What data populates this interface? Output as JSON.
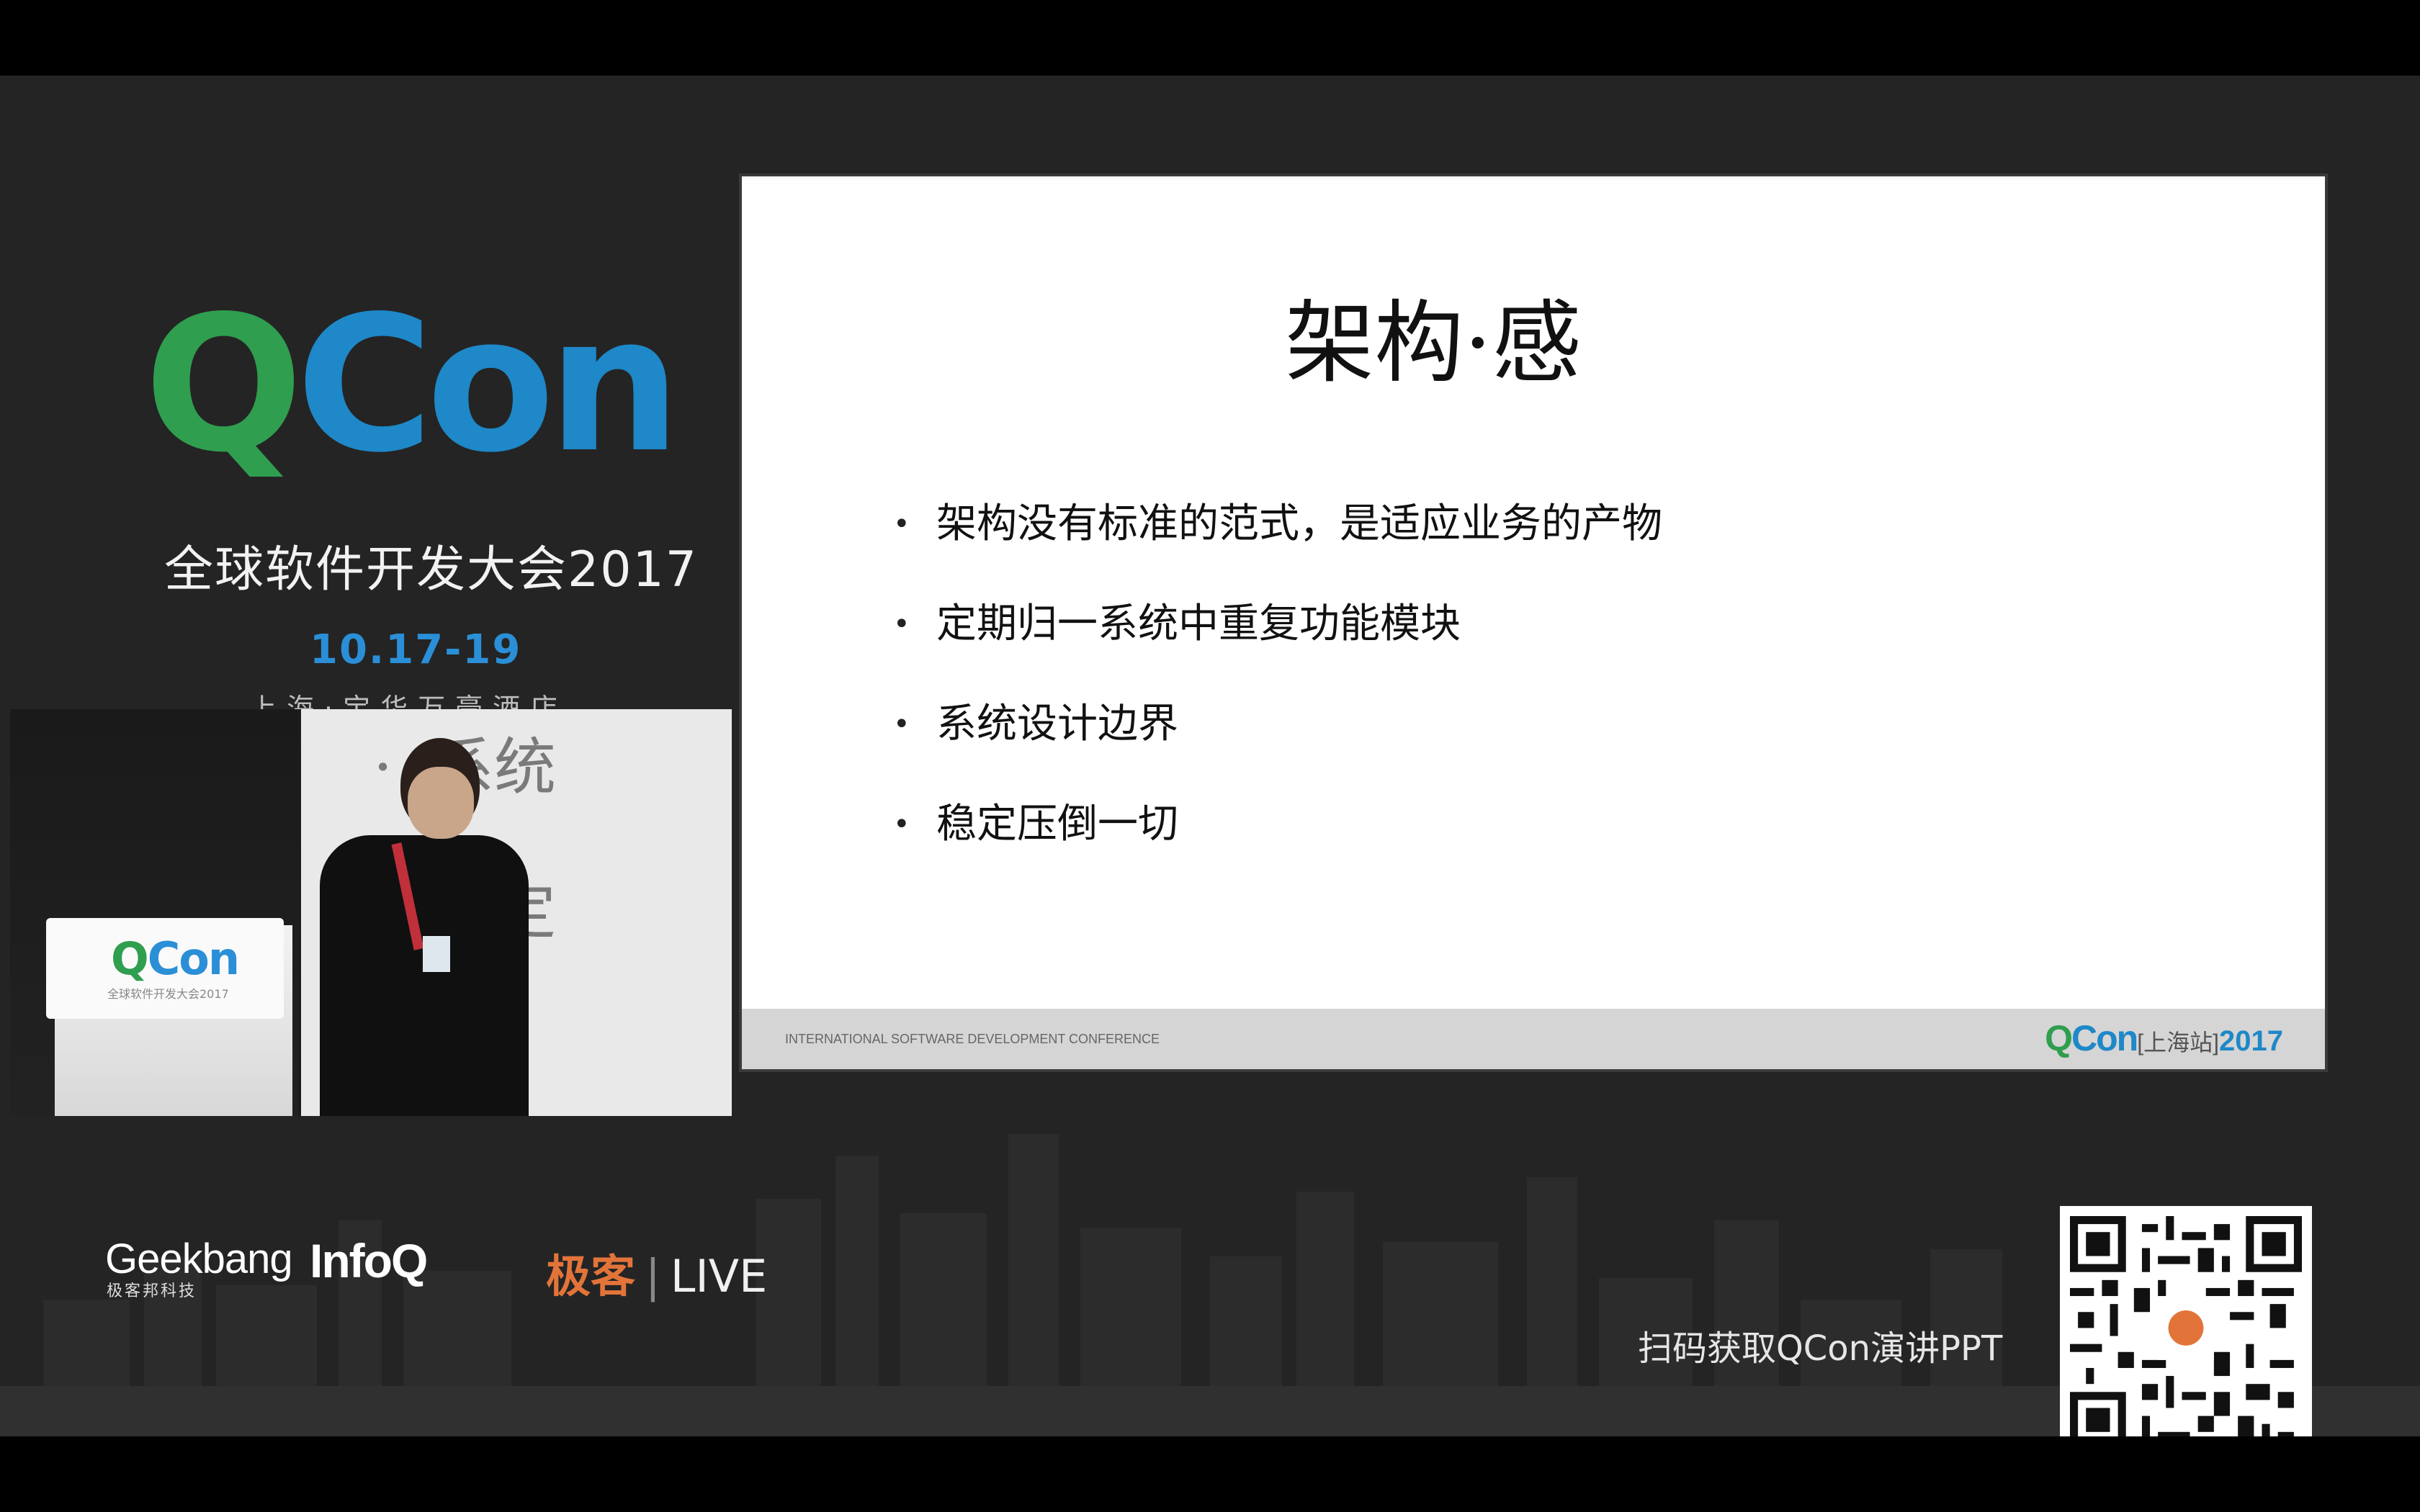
{
  "brand": {
    "logo_q": "Q",
    "logo_con": "Con",
    "conference_name": "全球软件开发大会2017",
    "dates": "10.17-19",
    "venue": "上海·宝华万豪酒店"
  },
  "camera": {
    "slide_line_1": "系统",
    "slide_line_2": "稳定",
    "podium_logo_q": "Q",
    "podium_logo_con": "Con",
    "podium_sub": "全球软件开发大会2017"
  },
  "slide": {
    "title": "架构·感",
    "bullets": [
      "架构没有标准的范式，是适应业务的产物",
      "定期归一系统中重复功能模块",
      "系统设计边界",
      "稳定压倒一切"
    ],
    "footer_text": "INTERNATIONAL SOFTWARE DEVELOPMENT CONFERENCE",
    "footer_logo_q": "Q",
    "footer_logo_con": "Con",
    "footer_logo_site": "[上海站]",
    "footer_logo_year": "2017"
  },
  "sponsors": {
    "geekbang_main": "Geekbang",
    "geekbang_sub": "极客邦科技",
    "infoq": "InfoQ",
    "live_brand": "极客",
    "live_word": "LIVE"
  },
  "qr_caption": "扫码获取QCon演讲PPT",
  "colors": {
    "qcon_green": "#2f9e4f",
    "qcon_blue": "#1e88c8",
    "live_orange": "#e2743a",
    "background": "#242424"
  }
}
